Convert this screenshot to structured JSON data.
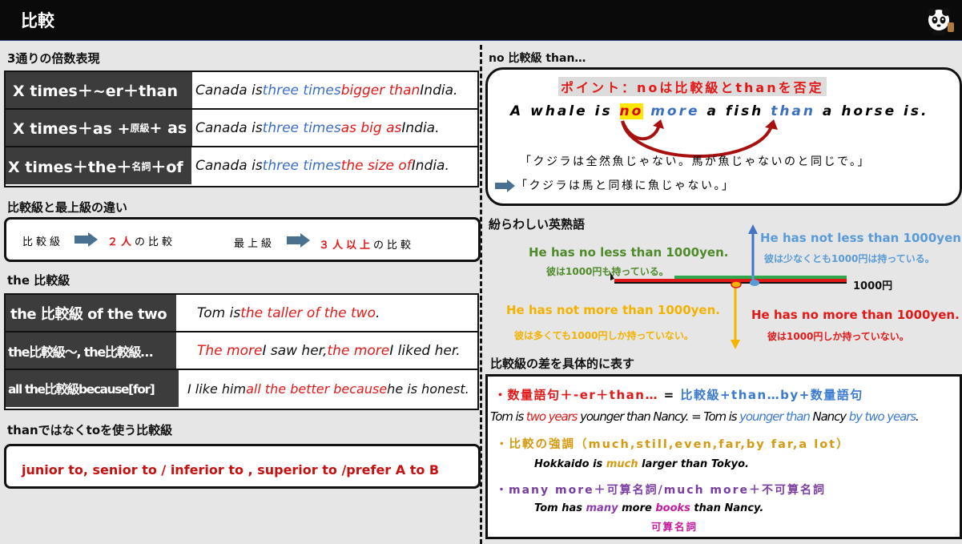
{
  "header": {
    "title": "比較"
  },
  "left": {
    "sec1_title": "3通りの倍数表現",
    "times_rows": [
      {
        "l1": "X times＋~er＋than",
        "l2": "",
        "l3": "",
        "r1": "Canada is ",
        "r2": "three times",
        "r3": " bigger than",
        "r4": " India."
      },
      {
        "l1": "X times＋as + ",
        "l2": "原級",
        "l3": " + as",
        "r1": "Canada is ",
        "r2": "three times",
        "r3": " as big as",
        "r4": " India."
      },
      {
        "l1": "X times＋the＋",
        "l2": "名詞",
        "l3": "＋of",
        "r1": "Canada is ",
        "r2": "three times",
        "r3": " the size of",
        "r4": " India."
      }
    ],
    "sec2_title": "比較級と最上級の違い",
    "diff": {
      "a_label": "比較級",
      "a_red": "２人",
      "a_rest": "の比較",
      "b_label": "最上級",
      "b_red": "３人以上",
      "b_rest": "の比較"
    },
    "sec3_title": "the 比較級",
    "the_rows": [
      {
        "label": "the 比較級 of the two",
        "p1": "Tom is ",
        "p2": "the taller of the two",
        "p3": ".",
        "p4": "",
        "p5": ""
      },
      {
        "label": "the比較級～, the比較級…",
        "p1": "",
        "p2": "The more",
        "p3": " I saw her, ",
        "p4": "the more",
        "p5": " I liked her."
      },
      {
        "label": "all the比較級because[for]",
        "p1": "I like him ",
        "p2": "all the better because",
        "p3": " he is honest.",
        "p4": "",
        "p5": ""
      }
    ],
    "sec4_title": "thanではなくtoを使う比較級",
    "to_list": "junior to, senior to / inferior to , superior to /prefer A to B"
  },
  "right": {
    "sec1_title": "no 比較級 than…",
    "point": "ポイント：noは比較級とthanを否定",
    "sentence": {
      "w1": "A whale is ",
      "w2": "no",
      "w3": " more",
      "w4": " a fish ",
      "w5": "than",
      "w6": " a horse is."
    },
    "trans1": "「クジラは全然魚じゃない。馬が魚じゃないのと同じで。」",
    "trans2": "「クジラは馬と同様に魚じゃない。」",
    "sec2_title": "紛らわしい英熟語",
    "idioms": {
      "no_less": "He has no less than 1000yen.",
      "no_less_jp": "彼は1000円も持っている。",
      "not_less": "He has not less than 1000yen.",
      "not_less_jp": "彼は少なくとも1000円は持っている。",
      "axis_label": "1000円",
      "not_more": "He has not more than 1000yen.",
      "not_more_jp": "彼は多くても1000円しか持っていない。",
      "no_more": "He has no more than 1000yen.",
      "no_more_jp": "彼は1000円しか持っていない。"
    },
    "sec3_title": "比較級の差を具体的に表す",
    "diff": {
      "l1a": "・数量語句＋-er＋than…",
      "l1b": " = ",
      "l1c": "比較級+than…by+数量語句",
      "ex_a": "Tom is ",
      "ex_b": "two years",
      "ex_c": " younger than",
      "ex_d": " Nancy. = Tom is ",
      "ex_e": "younger than",
      "ex_f": " Nancy ",
      "ex_g": "by two years",
      "ex_h": ".",
      "l2": "・比較の強調（much,still,even,far,by far,a lot）",
      "ex2a": "Hokkaido is ",
      "ex2b": "much",
      "ex2c": " larger than Tokyo.",
      "l3": "・many more＋可算名詞/much more＋不可算名詞",
      "ex3a": "Tom has ",
      "ex3b": "many",
      "ex3c": " more ",
      "ex3d": "books",
      "ex3e": " than Nancy.",
      "note": "可算名詞"
    }
  }
}
